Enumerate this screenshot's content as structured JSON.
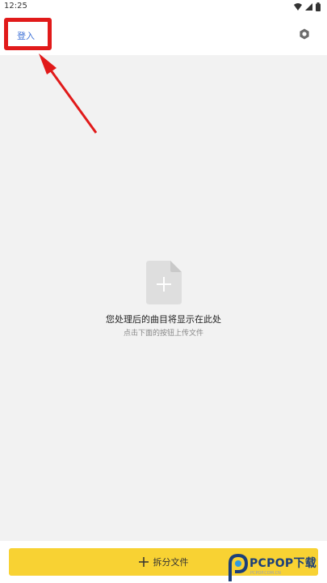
{
  "status_bar": {
    "time": "12:25"
  },
  "top_bar": {
    "login_label": "登入",
    "settings_icon": "settings-icon"
  },
  "empty_state": {
    "icon": "file-add-icon",
    "title": "您处理后的曲目将显示在此处",
    "subtitle": "点击下面的按钮上传文件"
  },
  "bottom": {
    "split_label": "拆分文件",
    "split_icon": "plus-icon"
  },
  "watermark": {
    "text": "PCPOP下载",
    "subtext": "PCPOP.COM.CN"
  },
  "colors": {
    "accent": "#f8d233",
    "highlight": "#e11a1a",
    "link": "#3b6fd6"
  }
}
